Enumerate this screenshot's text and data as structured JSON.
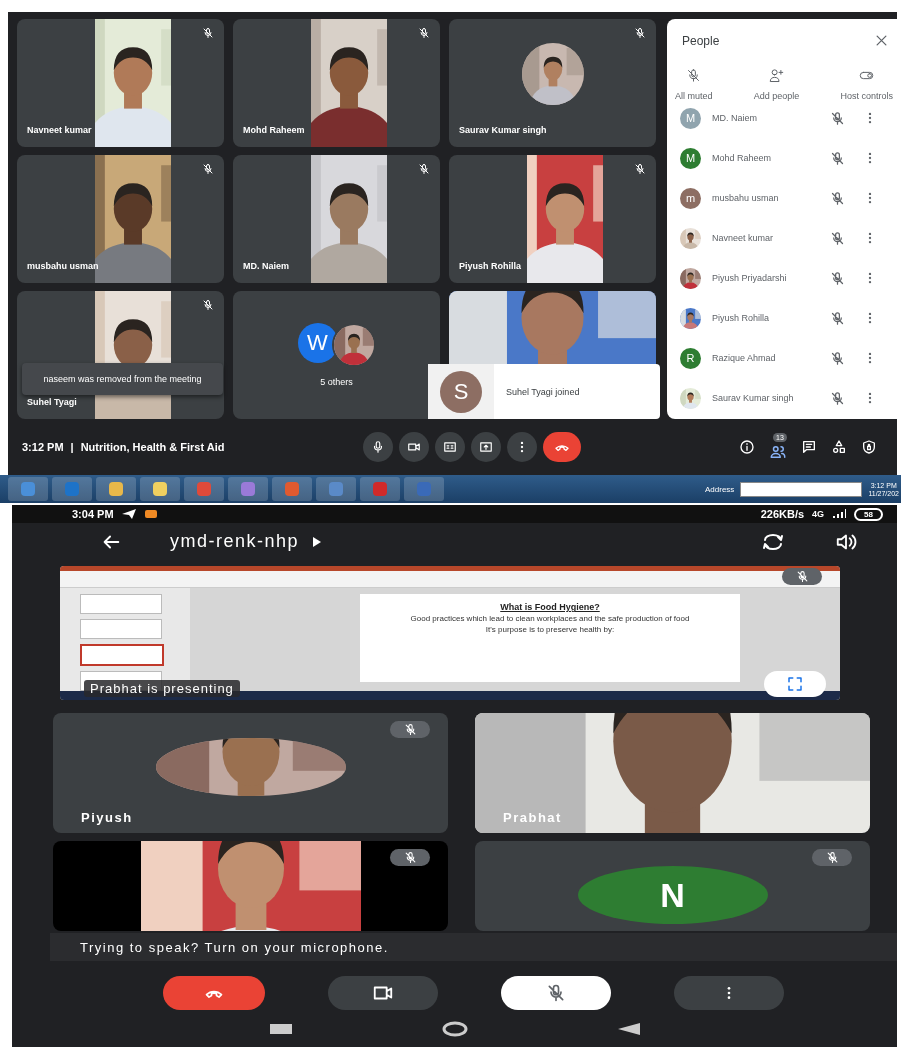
{
  "desktop": {
    "tiles": [
      {
        "name": "Navneet kumar",
        "kind": "portrait",
        "muted": true
      },
      {
        "name": "Mohd Raheem",
        "kind": "portrait",
        "muted": true
      },
      {
        "name": "Saurav Kumar singh",
        "kind": "avatar",
        "muted": true
      },
      {
        "name": "musbahu usman",
        "kind": "portrait",
        "muted": true
      },
      {
        "name": "MD. Naiem",
        "kind": "portrait",
        "muted": true
      },
      {
        "name": "Piyush Rohilla",
        "kind": "portrait",
        "muted": true
      },
      {
        "name": "Suhel Tyagi",
        "kind": "portrait",
        "muted": true
      },
      {
        "name": "5 others",
        "kind": "group",
        "initial": "W",
        "color": "#1a73e8",
        "muted": false
      },
      {
        "kind": "wide",
        "muted": false
      }
    ],
    "toast": "naseem was removed from the meeting",
    "join_toast": {
      "initial": "S",
      "color": "#8d6e63",
      "text": "Suhel Tyagi joined"
    },
    "people_panel": {
      "title": "People",
      "actions": [
        "All muted",
        "Add people",
        "Host controls"
      ],
      "participants": [
        {
          "name": "MD. Naiem",
          "kind": "initial",
          "initial": "M",
          "color": "#90a4ae",
          "muted": true
        },
        {
          "name": "Mohd Raheem",
          "kind": "initial",
          "initial": "M",
          "color": "#2e7d32",
          "muted": true
        },
        {
          "name": "musbahu usman",
          "kind": "initial",
          "initial": "m",
          "color": "#8d6e63",
          "muted": true
        },
        {
          "name": "Navneet kumar",
          "muted": true
        },
        {
          "name": "Piyush Priyadarshi",
          "muted": true
        },
        {
          "name": "Piyush Rohilla",
          "muted": true
        },
        {
          "name": "Razique Ahmad",
          "kind": "initial",
          "initial": "R",
          "color": "#2e7d32",
          "muted": true
        },
        {
          "name": "Saurav Kumar singh",
          "muted": true
        }
      ]
    },
    "bottom_bar": {
      "time": "3:12 PM",
      "separator": "|",
      "meeting": "Nutrition, Health & First Aid",
      "people_count": "13"
    }
  },
  "taskbar": {
    "address_label": "Address",
    "time": "3:12 PM",
    "date": "11/27/202"
  },
  "phone": {
    "status_bar": {
      "time": "3:04 PM",
      "speed": "226KB/s",
      "network": "4G",
      "battery": "58"
    },
    "header": {
      "meeting_code": "ymd-renk-nhp"
    },
    "presentation": {
      "slide_title": "What is Food Hygiene?",
      "slide_text": "Good practices which lead to clean workplaces and the safe production of food",
      "slide_line": "It's purpose is to preserve health by:",
      "presenter_label": "Prabhat is presenting"
    },
    "tiles": [
      {
        "name": "Piyush",
        "kind": "avatar",
        "muted": true
      },
      {
        "name": "Prabhat",
        "kind": "wide",
        "muted": false
      },
      {
        "kind": "portrait",
        "muted": true
      },
      {
        "kind": "initial",
        "initial": "N",
        "color": "#2e7d32",
        "muted": true
      }
    ],
    "mic_hint": "Trying to speak? Turn on your microphone."
  }
}
